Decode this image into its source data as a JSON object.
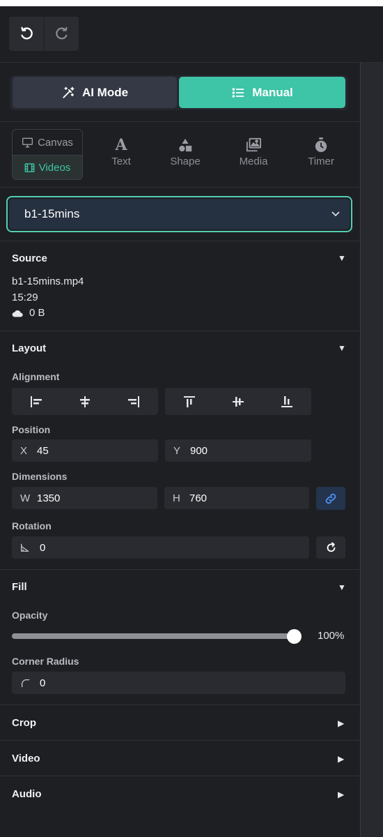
{
  "toolbar": {
    "undo_icon": "undo-icon",
    "redo_icon": "redo-icon"
  },
  "mode": {
    "ai_label": "AI Mode",
    "manual_label": "Manual",
    "active": "Manual",
    "accent": "#3ec4a7"
  },
  "element_tabs": {
    "canvas_label": "Canvas",
    "videos_label": "Videos",
    "text_label": "Text",
    "shape_label": "Shape",
    "media_label": "Media",
    "timer_label": "Timer"
  },
  "selected_item": {
    "value": "b1-15mins"
  },
  "source": {
    "title": "Source",
    "filename": "b1-15mins.mp4",
    "duration": "15:29",
    "size": "0 B"
  },
  "layout": {
    "title": "Layout",
    "alignment_label": "Alignment",
    "position_label": "Position",
    "x_key": "X",
    "x_value": "45",
    "y_key": "Y",
    "y_value": "900",
    "dimensions_label": "Dimensions",
    "w_key": "W",
    "w_value": "1350",
    "h_key": "H",
    "h_value": "760",
    "rotation_label": "Rotation",
    "rotation_value": "0"
  },
  "fill": {
    "title": "Fill",
    "opacity_label": "Opacity",
    "opacity_value": "100%",
    "opacity_fraction": 1.0,
    "corner_radius_label": "Corner Radius",
    "corner_radius_value": "0"
  },
  "collapsed_sections": {
    "crop": "Crop",
    "video": "Video",
    "audio": "Audio"
  }
}
